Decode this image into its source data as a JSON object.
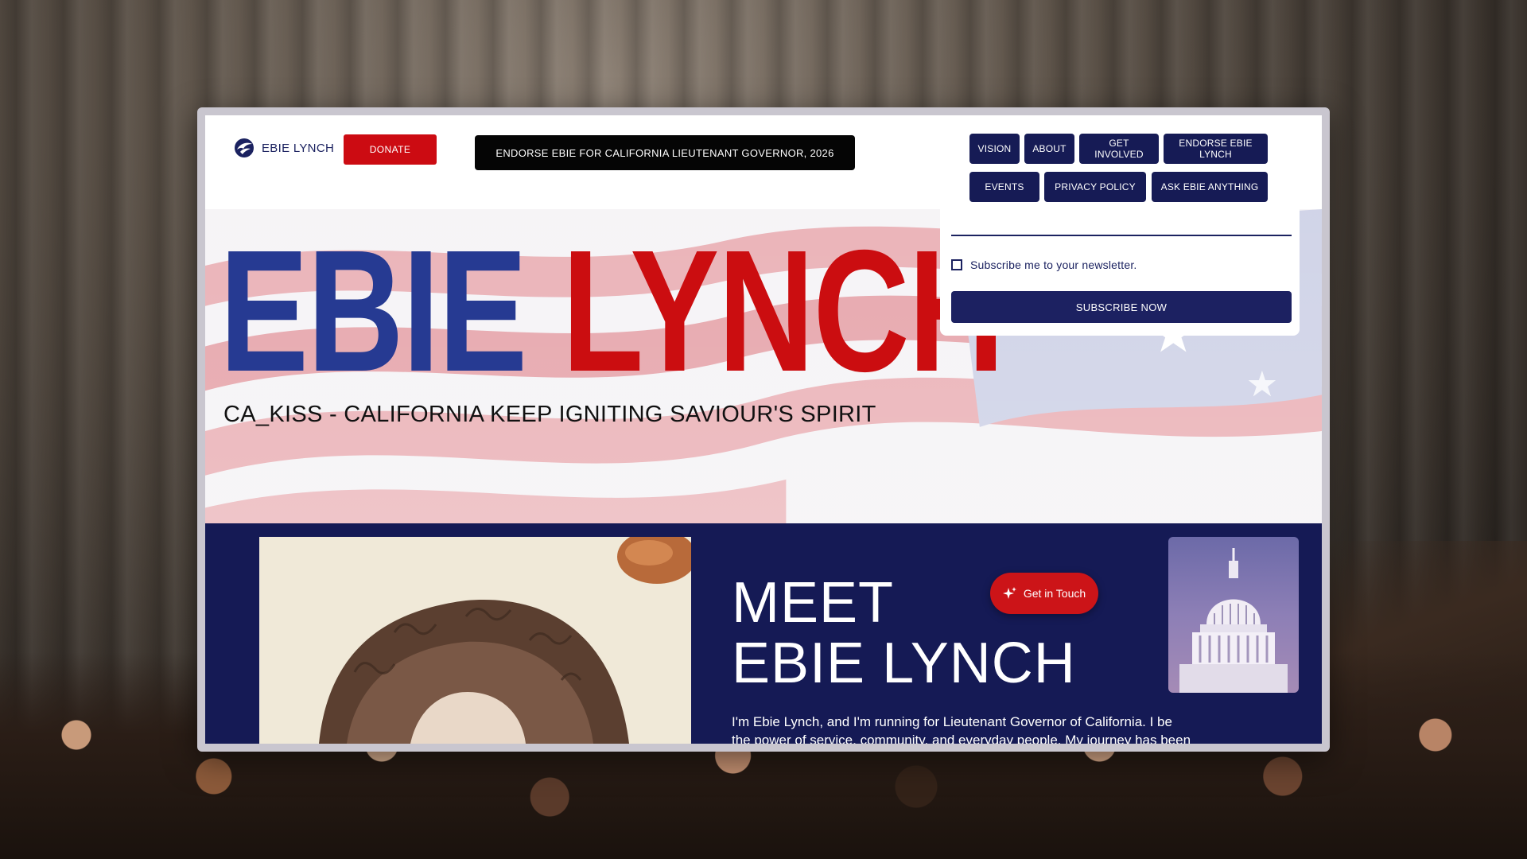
{
  "brand": {
    "logo_text": "EBIE LYNCH"
  },
  "header": {
    "donate_label": "DONATE",
    "endorse_banner": "ENDORSE EBIE FOR CALIFORNIA LIEUTENANT GOVERNOR, 2026"
  },
  "nav": {
    "row1": [
      "VISION",
      "ABOUT",
      "GET INVOLVED",
      "ENDORSE EBIE LYNCH"
    ],
    "row2": [
      "EVENTS",
      "PRIVACY POLICY",
      "ASK EBIE ANYTHING"
    ]
  },
  "hero": {
    "title_first": "EBIE",
    "title_last": "LYNCH",
    "subtitle": "CA_KISS - CALIFORNIA KEEP IGNITING SAVIOUR'S SPIRIT"
  },
  "subscribe": {
    "checkbox_label": "Subscribe me to your newsletter.",
    "button_label": "SUBSCRIBE NOW"
  },
  "meet": {
    "title_line1": "MEET",
    "title_line2": "EBIE LYNCH",
    "body_line1": "I'm Ebie Lynch, and I'm running for Lieutenant Governor of California. I be",
    "body_line2": "the power of service, community, and everyday people. My journey has been"
  },
  "chat": {
    "label": "Get in Touch"
  },
  "colors": {
    "navy": "#161b55",
    "red": "#cc0b12",
    "title_blue": "#263a92",
    "title_red": "#cb0d10"
  }
}
